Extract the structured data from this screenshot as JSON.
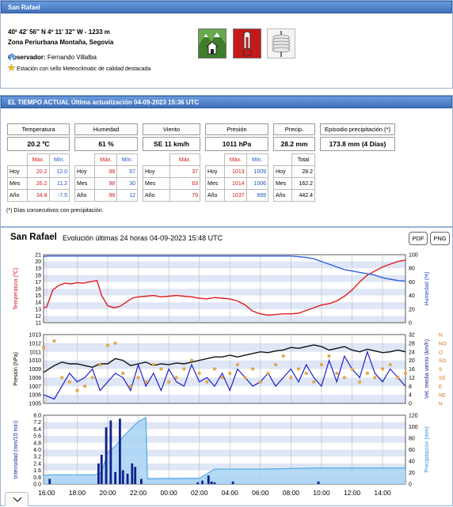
{
  "station": {
    "title": "San Rafael",
    "coords": "40º 42' 56'' N   4º 11' 32'' W  -  1233 m",
    "zone": "Zona Periurbana Montaña, Segovia",
    "observer_label": "Observador:",
    "observer_name": "Fernando Villalba",
    "seal_text": "Estación con sello Meteoclimatic de calidad destacada",
    "icons": [
      "home-landscape-icon",
      "thermometer-icon",
      "weather-station-icon"
    ]
  },
  "current": {
    "header": "EL TIEMPO ACTUAL Última actualización 04-09-2023 15:36 UTC",
    "temperature": {
      "label": "Temperatura",
      "value": "20.2 ºC"
    },
    "humidity": {
      "label": "Humedad",
      "value": "61 %"
    },
    "wind": {
      "label": "Viento",
      "value": "SE  11 km/h"
    },
    "pressure": {
      "label": "Presión",
      "value": "1011 hPa"
    },
    "precip": {
      "label": "Precip.",
      "value": "28.2 mm"
    },
    "episode": {
      "label": "Episodio precipitación (*)",
      "value": "173.8 mm (4 Días)"
    },
    "col_max": "Máx.",
    "col_min": "Mín.",
    "col_total": "Total",
    "rows": [
      "Hoy",
      "Mes",
      "Año"
    ],
    "temp_rows": [
      [
        "20.2",
        "12.0"
      ],
      [
        "26.2",
        "11.2"
      ],
      [
        "34.8",
        "-7.5"
      ]
    ],
    "hum_rows": [
      [
        "98",
        "57"
      ],
      [
        "98",
        "30"
      ],
      [
        "98",
        "12"
      ]
    ],
    "wind_rows": [
      "37",
      "63",
      "79"
    ],
    "press_rows": [
      [
        "1013",
        "1009"
      ],
      [
        "1014",
        "1006"
      ],
      [
        "1037",
        "999"
      ]
    ],
    "precip_rows": [
      "28.2",
      "162.2",
      "442.4"
    ],
    "footnote": "(*) Días consecutivos con precipitación."
  },
  "evolution": {
    "station": "San Rafael",
    "subtitle": "Evolución últimas 24 horas 04-09-2023 15:48 UTC",
    "pdf_label": "PDF",
    "png_label": "PNG"
  },
  "colors": {
    "header_blue": "#4a7ec8",
    "temp_red": "#e01c1c",
    "hum_blue": "#3060e0",
    "wind_orange": "#e8a020",
    "rain_fill": "#a8d4f4",
    "bar_navy": "#10208a"
  },
  "chart_data": [
    {
      "type": "line",
      "ylabel": "Temperatura (ºC)",
      "y2label": "Humedad (%)",
      "ylim": [
        11,
        21
      ],
      "y2lim": [
        0,
        100
      ],
      "yticks": [
        "11",
        "12",
        "13",
        "14",
        "15",
        "16",
        "17",
        "18",
        "19",
        "20",
        "21"
      ],
      "y2ticks": [
        "0",
        "20",
        "40",
        "60",
        "80",
        "100"
      ],
      "x_hours": [
        15.8,
        16.0,
        16.4,
        16.8,
        17.2,
        17.6,
        18.0,
        18.4,
        18.8,
        19.3,
        19.6,
        20.0,
        20.4,
        20.8,
        21.2,
        21.6,
        22.0,
        22.5,
        23.0,
        23.5,
        24.0,
        24.5,
        25.0,
        25.5,
        26.0,
        26.5,
        27.0,
        27.5,
        28.0,
        28.5,
        29.0,
        29.5,
        30.0,
        30.5,
        31.0,
        31.5,
        32.0,
        32.5,
        33.0,
        33.5,
        34.0,
        34.5,
        35.0,
        35.5,
        36.0,
        36.5,
        37.0,
        37.5,
        38.0,
        38.5,
        39.0,
        39.5
      ],
      "series": [
        {
          "name": "Temperatura",
          "color": "#e01c1c",
          "axis": "left",
          "values": [
            13.2,
            13.3,
            15.8,
            16.5,
            16.8,
            16.7,
            16.9,
            16.8,
            17.0,
            17.2,
            15.0,
            13.5,
            13.2,
            13.4,
            14.0,
            14.6,
            14.8,
            14.9,
            15.0,
            14.8,
            14.9,
            15.0,
            14.9,
            14.8,
            14.6,
            14.5,
            14.7,
            14.6,
            14.5,
            14.2,
            13.6,
            12.7,
            12.3,
            12.1,
            12.2,
            12.3,
            12.3,
            12.4,
            12.8,
            13.2,
            13.6,
            13.8,
            14.2,
            14.9,
            15.8,
            17.0,
            18.0,
            18.6,
            19.2,
            19.6,
            20.0,
            20.2
          ]
        },
        {
          "name": "Humedad",
          "color": "#3060e0",
          "axis": "right",
          "values": [
            97,
            98,
            98,
            98,
            98,
            98,
            98,
            98,
            98,
            98,
            98,
            98,
            98,
            98,
            98,
            98,
            98,
            98,
            98,
            98,
            98,
            98,
            98,
            98,
            98,
            98,
            98,
            98,
            98,
            98,
            98,
            98,
            98,
            98,
            98,
            98,
            98,
            97,
            96,
            94,
            90,
            86,
            82,
            78,
            76,
            74,
            72,
            70,
            66,
            64,
            62,
            61
          ]
        }
      ]
    },
    {
      "type": "line",
      "ylabel": "Presión (hPa)",
      "y2label": "Vel. media viento (km/h)",
      "ylim": [
        1005,
        1013
      ],
      "y2lim": [
        0,
        32
      ],
      "yticks": [
        "1005",
        "1006",
        "1007",
        "1008",
        "1009",
        "1010",
        "1011",
        "1012",
        "1013"
      ],
      "y2ticks": [
        "0",
        "4",
        "8",
        "12",
        "16",
        "20",
        "24",
        "28",
        "32"
      ],
      "y3ticks": [
        "N",
        "NE",
        "E",
        "SE",
        "S",
        "SO",
        "O",
        "NO",
        "N"
      ],
      "x_hours": [
        15.8,
        16.5,
        17.0,
        17.5,
        18.0,
        18.5,
        19.0,
        19.5,
        20.0,
        20.5,
        21.0,
        21.5,
        22.0,
        22.5,
        23.0,
        23.5,
        24.0,
        24.5,
        25.0,
        25.5,
        26.0,
        26.5,
        27.0,
        27.5,
        28.0,
        28.5,
        29.0,
        29.5,
        30.0,
        30.5,
        31.0,
        31.5,
        32.0,
        32.5,
        33.0,
        33.5,
        34.0,
        34.5,
        35.0,
        35.5,
        36.0,
        36.5,
        37.0,
        37.5,
        38.0,
        38.5,
        39.0,
        39.5
      ],
      "series": [
        {
          "name": "Presión",
          "color": "#111111",
          "axis": "left",
          "values": [
            1008.6,
            1009.4,
            1009.8,
            1009.6,
            1009.6,
            1009.4,
            1009.2,
            1009.6,
            1009.6,
            1010.2,
            1010.0,
            1009.4,
            1009.6,
            1009.8,
            1009.4,
            1009.6,
            1009.5,
            1009.7,
            1009.6,
            1009.8,
            1010.0,
            1010.2,
            1010.4,
            1010.4,
            1010.6,
            1010.4,
            1010.6,
            1010.8,
            1011.0,
            1010.9,
            1011.1,
            1011.2,
            1011.5,
            1011.4,
            1011.6,
            1011.8,
            1011.6,
            1011.2,
            1011.4,
            1011.6,
            1011.2,
            1011.0,
            1011.3,
            1011.1,
            1010.9,
            1011.0,
            1011.2,
            1011.0
          ]
        },
        {
          "name": "Viento",
          "color": "#2020c8",
          "axis": "right",
          "values": [
            4,
            2,
            8,
            14,
            10,
            12,
            16,
            6,
            10,
            14,
            12,
            6,
            18,
            8,
            14,
            6,
            16,
            10,
            8,
            18,
            10,
            12,
            8,
            14,
            6,
            16,
            12,
            8,
            10,
            14,
            8,
            12,
            16,
            10,
            18,
            12,
            8,
            20,
            10,
            22,
            16,
            12,
            24,
            14,
            10,
            16,
            12,
            8
          ]
        },
        {
          "name": "Dirección",
          "color": "#e8a020",
          "axis": "right",
          "values": [
            26,
            29,
            12,
            10,
            6,
            8,
            12,
            18,
            27,
            28,
            14,
            8,
            12,
            10,
            18,
            16,
            10,
            12,
            16,
            20,
            14,
            10,
            16,
            12,
            14,
            18,
            12,
            16,
            10,
            14,
            18,
            22,
            12,
            16,
            14,
            10,
            18,
            22,
            14,
            12,
            16,
            10,
            14,
            12,
            16,
            18,
            12,
            14
          ]
        }
      ]
    },
    {
      "type": "bar",
      "ylabel": "Intensidad (mm/15 min)",
      "y2label": "Precipitación (mm)",
      "ylim": [
        0,
        8
      ],
      "y2lim": [
        0,
        120
      ],
      "yticks": [
        "0.0",
        "0.8",
        "1.6",
        "2.4",
        "3.2",
        "4.0",
        "4.8",
        "5.6",
        "6.4",
        "7.2",
        "8.0"
      ],
      "y2ticks": [
        "0",
        "20",
        "40",
        "60",
        "80",
        "100",
        "120"
      ],
      "xticks": [
        "16:00",
        "18:00",
        "20:00",
        "22:00",
        "00:00",
        "02:00",
        "04:00",
        "06:00",
        "08:00",
        "10:00",
        "12:00",
        "14:00"
      ],
      "x_hours": [
        16.2,
        19.4,
        19.6,
        19.9,
        20.2,
        20.5,
        20.8,
        21.0,
        21.3,
        21.6,
        21.8,
        22.2,
        25.9,
        26.2,
        26.6,
        26.8,
        27.0,
        28.2,
        33.8
      ],
      "series": [
        {
          "name": "Intensidad",
          "color": "#10208a",
          "axis": "left",
          "values": [
            0.6,
            2.4,
            3.4,
            6.6,
            7.4,
            1.4,
            7.6,
            1.6,
            1.2,
            2.4,
            2.0,
            0.6,
            0.2,
            0.4,
            1.0,
            0.3,
            0.2,
            0.3,
            0.3
          ]
        },
        {
          "name": "Acumulado",
          "color": "#5aaee8",
          "axis": "right",
          "x_hours": [
            15.8,
            16.2,
            19.2,
            19.6,
            20.0,
            20.5,
            21.0,
            21.5,
            22.0,
            22.5,
            22.6,
            26.0,
            27.0,
            30.0,
            33.8,
            39.5
          ],
          "values": [
            15,
            16,
            16,
            21,
            55,
            66,
            82,
            96,
            109,
            116,
            9,
            10,
            26,
            26,
            28,
            28
          ]
        }
      ]
    }
  ]
}
